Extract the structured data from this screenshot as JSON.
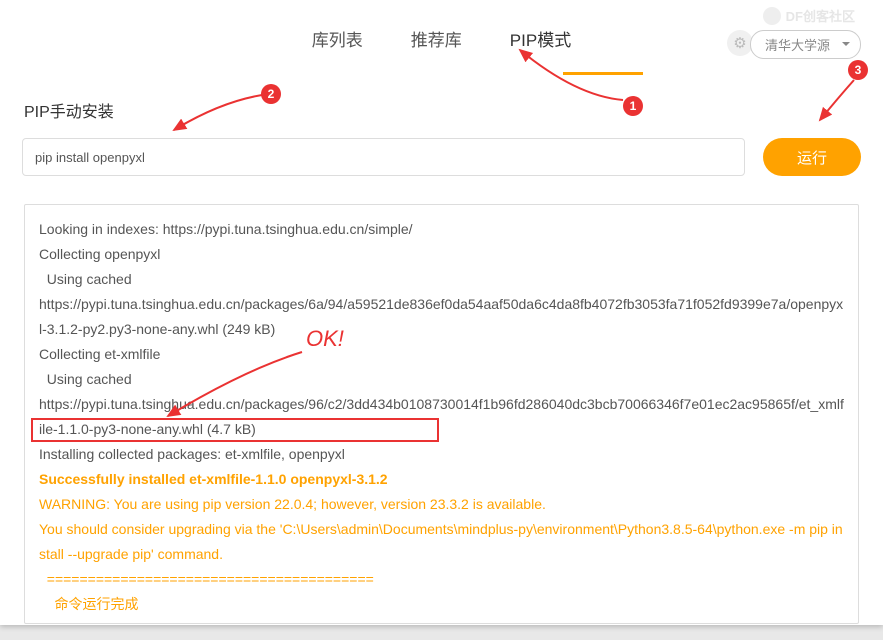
{
  "watermark": "DF创客社区",
  "tabs": {
    "lib": "库列表",
    "rec": "推荐库",
    "pip": "PIP模式"
  },
  "source_select": "清华大学源",
  "section_title": "PIP手动安装",
  "input_value": "pip install openpyxl",
  "run_label": "运行",
  "annotations": {
    "ok": "OK!",
    "n1": "1",
    "n2": "2",
    "n3": "3"
  },
  "output": {
    "l1": "Looking in indexes: https://pypi.tuna.tsinghua.edu.cn/simple/",
    "l2": "Collecting openpyxl",
    "l3": "  Using cached",
    "l4": "https://pypi.tuna.tsinghua.edu.cn/packages/6a/94/a59521de836ef0da54aaf50da6c4da8fb4072fb3053fa71f052fd9399e7a/openpyxl-3.1.2-py2.py3-none-any.whl (249 kB)",
    "l5": "Collecting et-xmlfile",
    "l6": "  Using cached",
    "l7": "https://pypi.tuna.tsinghua.edu.cn/packages/96/c2/3dd434b0108730014f1b96fd286040dc3bcb70066346f7e01ec2ac95865f/et_xmlfile-1.1.0-py3-none-any.whl (4.7 kB)",
    "l8": "Installing collected packages: et-xmlfile, openpyxl",
    "l9": "Successfully installed et-xmlfile-1.1.0 openpyxl-3.1.2",
    "l10": "WARNING: You are using pip version 22.0.4; however, version 23.3.2 is available.",
    "l11": "You should consider upgrading via the 'C:\\Users\\admin\\Documents\\mindplus-py\\environment\\Python3.8.5-64\\python.exe -m pip install --upgrade pip' command.",
    "l12": "  ========================================",
    "l13": "    命令运行完成",
    "l14": "  ========================================"
  }
}
